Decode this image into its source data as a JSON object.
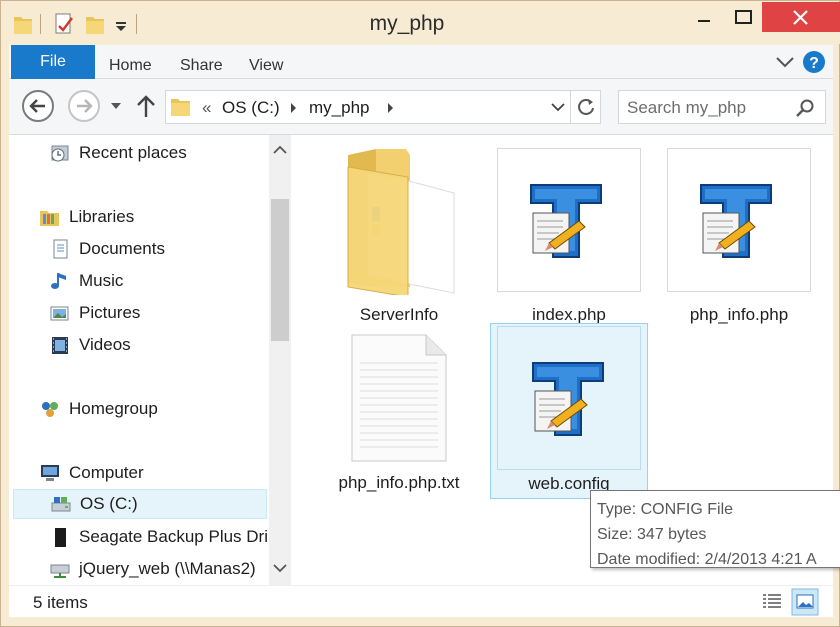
{
  "window": {
    "title": "my_php"
  },
  "ribbon": {
    "tabs": [
      "File",
      "Home",
      "Share",
      "View"
    ]
  },
  "address": {
    "overflow": "«",
    "crumbs": [
      "OS (C:)",
      "my_php"
    ]
  },
  "search": {
    "placeholder": "Search my_php"
  },
  "nav": {
    "recent": "Recent places",
    "libraries": "Libraries",
    "documents": "Documents",
    "music": "Music",
    "pictures": "Pictures",
    "videos": "Videos",
    "homegroup": "Homegroup",
    "computer": "Computer",
    "os_c": "OS (C:)",
    "seagate": "Seagate Backup Plus Dri",
    "jquery": "jQuery_web (\\\\Manas2)"
  },
  "files": [
    {
      "name": "ServerInfo",
      "icon": "folder-icon"
    },
    {
      "name": "index.php",
      "icon": "php-file-icon"
    },
    {
      "name": "php_info.php",
      "icon": "php-file-icon"
    },
    {
      "name": "php_info.php.txt",
      "icon": "text-file-icon"
    },
    {
      "name": "web.config",
      "icon": "php-file-icon"
    }
  ],
  "tooltip": {
    "type": "Type: CONFIG File",
    "size": "Size: 347 bytes",
    "date": "Date modified: 2/4/2013 4:21 A"
  },
  "status": {
    "count": "5 items"
  },
  "colors": {
    "accent": "#1979ca",
    "selection": "#e5f3fb",
    "close": "#e04343"
  }
}
